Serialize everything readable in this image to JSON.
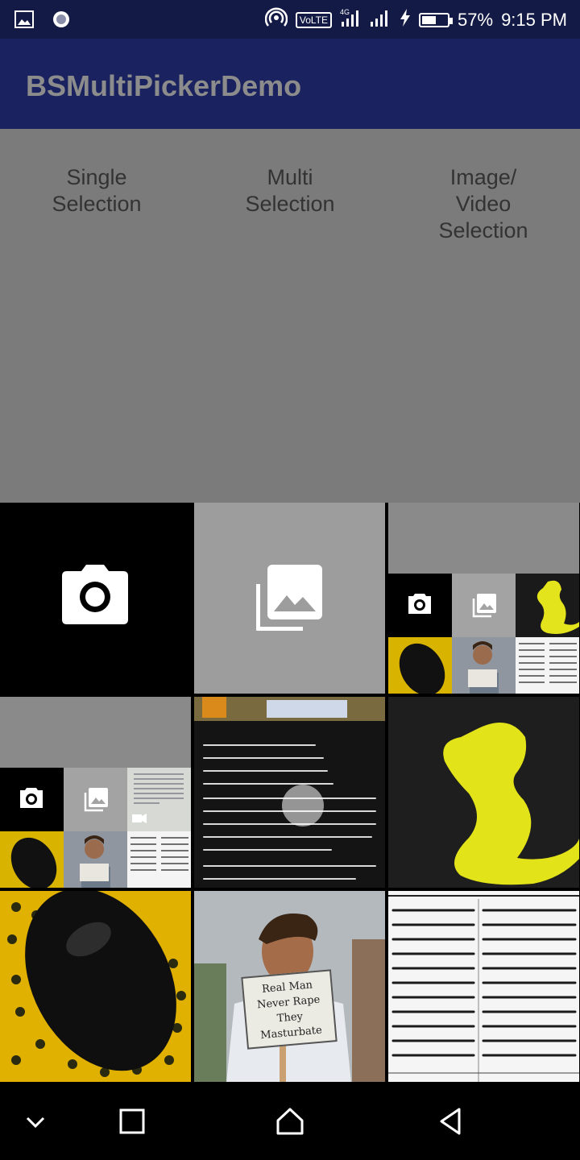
{
  "status_bar": {
    "network": "4G",
    "volte": "VoLTE",
    "battery_percent": "57%",
    "battery_level": 0.57,
    "time": "9:15 PM",
    "icons": [
      "gallery-notification-icon",
      "sync-icon",
      "hotspot-icon",
      "signal-icon",
      "charging-icon",
      "battery-icon"
    ]
  },
  "app_bar": {
    "title": "BSMultiPickerDemo"
  },
  "buttons": {
    "single": "Single\nSelection",
    "multi": "Multi\nSelection",
    "image_video": "Image/\nVideo\nSelection"
  },
  "grid": {
    "tiles": [
      "camera",
      "gallery",
      "screenshot-picker",
      "screenshot-picker-video",
      "book-page-photo",
      "yellow-figure-photo",
      "mouse-photo",
      "person-with-sign-photo",
      "newspaper-photo"
    ]
  },
  "photos": {
    "sign_text_1": "Real Man",
    "sign_text_2": "Never Rape",
    "sign_text_3": "They",
    "sign_text_4": "Masturbate"
  },
  "nav_bar": {
    "icons": [
      "chevron-down-icon",
      "recents-icon",
      "home-icon",
      "back-icon"
    ]
  },
  "colors": {
    "status_bar": "#131a45",
    "app_bar": "#1a2260",
    "content_bg": "#7b7b7b",
    "gallery_tile": "#9d9d9d",
    "nav_bar": "#000000"
  }
}
